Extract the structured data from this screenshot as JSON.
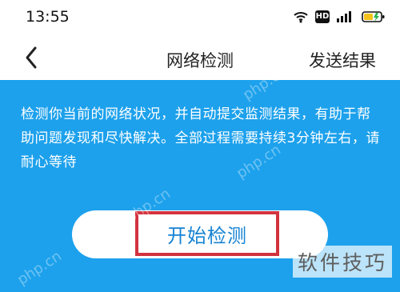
{
  "status_bar": {
    "time": "13:55",
    "icons": [
      "wifi-icon",
      "hd-icon",
      "signal-icon",
      "battery-icon"
    ],
    "hd_label": "HD"
  },
  "nav": {
    "back_icon": "chevron-left-icon",
    "title": "网络检测",
    "send_results": "发送结果"
  },
  "info": {
    "description": "检测你当前的网络状况，并自动提交监测结果，有助于帮助问题发现和尽快解决。全部过程需要持续3分钟左右，请耐心等待"
  },
  "actions": {
    "start_button": "开始检测"
  },
  "watermarks": {
    "text": "php.cn",
    "logo": "软件技巧"
  },
  "colors": {
    "panel_blue": "#1da1ec",
    "button_text": "#1683d3",
    "highlight_red": "#d2333f"
  }
}
